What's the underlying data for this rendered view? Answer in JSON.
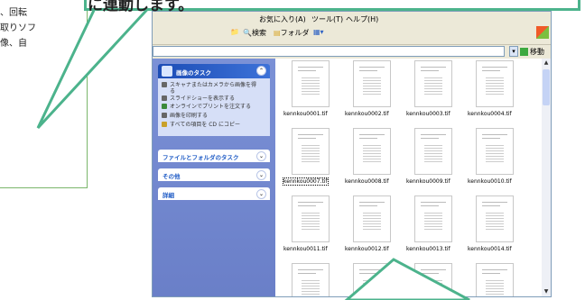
{
  "callout": {
    "text": "に連動します。"
  },
  "doc_text": {
    "line1": "、回転",
    "line2": "取りソフ",
    "line3": "像、自"
  },
  "window": {
    "menu": {
      "favorites": "お気に入り(A)",
      "tools": "ツール(T)",
      "help": "ヘルプ(H)"
    },
    "toolbar": {
      "search": "検索",
      "folders": "フォルダ",
      "views": ""
    },
    "address": {
      "go_label": "移動",
      "value": ""
    },
    "sidebar": {
      "image_tasks": {
        "title": "画像のタスク",
        "items": [
          "スキャナまたはカメラから画像を得る",
          "スライドショーを表示する",
          "オンラインでプリントを注文する",
          "画像を印刷する",
          "すべての項目を CD にコピー"
        ]
      },
      "file_folder_tasks": "ファイルとフォルダのタスク",
      "other_places": "その他",
      "details": "詳細"
    },
    "files": [
      {
        "name": "kennkou0001.tif",
        "selected": false
      },
      {
        "name": "kennkou0002.tif",
        "selected": false
      },
      {
        "name": "kennkou0003.tif",
        "selected": false
      },
      {
        "name": "kennkou0004.tif",
        "selected": false
      },
      {
        "name": "kennkou0007.tif",
        "selected": true
      },
      {
        "name": "kennkou0008.tif",
        "selected": false
      },
      {
        "name": "kennkou0009.tif",
        "selected": false
      },
      {
        "name": "kennkou0010.tif",
        "selected": false
      },
      {
        "name": "kennkou0011.tif",
        "selected": false
      },
      {
        "name": "kennkou0012.tif",
        "selected": false
      },
      {
        "name": "kennkou0013.tif",
        "selected": false
      },
      {
        "name": "kennkou0014.tif",
        "selected": false
      },
      {
        "name": "",
        "selected": false
      },
      {
        "name": "",
        "selected": false
      },
      {
        "name": "",
        "selected": false
      },
      {
        "name": "",
        "selected": false
      }
    ]
  },
  "colors": {
    "callout_border": "#4cb38c",
    "sidebar": "#6a7fc8",
    "panel_title": "#215dc6"
  }
}
